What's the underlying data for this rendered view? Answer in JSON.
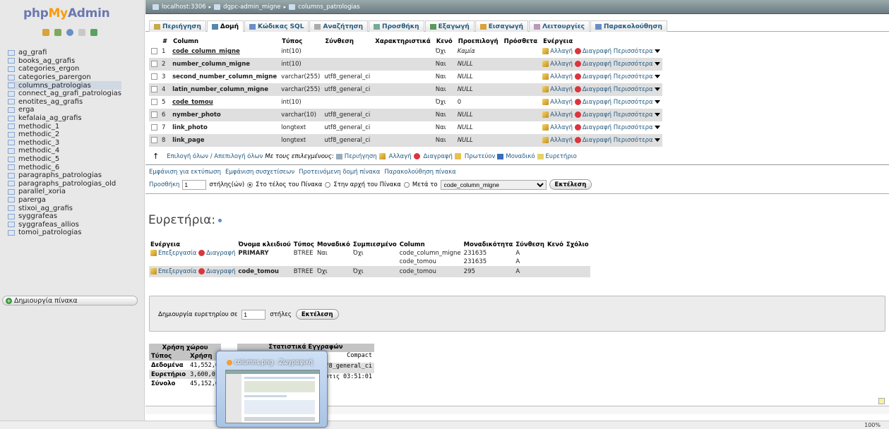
{
  "logo": {
    "php": "php",
    "my": "My",
    "admin": "Admin"
  },
  "sidebar": {
    "tables": [
      "ag_grafi",
      "books_ag_grafis",
      "categories_ergon",
      "categories_parergon",
      "columns_patrologias",
      "connect_ag_grafi_patrologias",
      "enotites_ag_grafis",
      "erga",
      "kefalaia_ag_grafis",
      "methodic_1",
      "methodic_2",
      "methodic_3",
      "methodic_4",
      "methodic_5",
      "methodic_6",
      "paragraphs_patrologias",
      "paragraphs_patrologias_old",
      "parallel_xoria",
      "parerga",
      "stixoi_ag_grafis",
      "syggrafeas",
      "syggrafeas_allios",
      "tomoi_patrologias"
    ],
    "selected_index": 4,
    "create_table": "Δημιουργία πίνακα"
  },
  "breadcrumb": {
    "server": "localhost:3306",
    "database": "dgpc-admin_migne",
    "table": "columns_patrologias"
  },
  "tabs": [
    "Περιήγηση",
    "Δομή",
    "Κώδικας SQL",
    "Αναζήτηση",
    "Προσθήκη",
    "Εξαγωγή",
    "Εισαγωγή",
    "Λειτουργίες",
    "Παρακολούθηση"
  ],
  "active_tab": 1,
  "structure": {
    "headers": [
      "#",
      "Column",
      "Τύπος",
      "Σύνθεση",
      "Χαρακτηριστικά",
      "Κενό",
      "Προεπιλογή",
      "Πρόσθετα",
      "Ενέργεια"
    ],
    "rows": [
      {
        "n": "1",
        "name": "code_column_migne",
        "underline": true,
        "type": "int(10)",
        "coll": "",
        "attr": "",
        "null": "Όχι",
        "def": "Καμία",
        "def_italic": true
      },
      {
        "n": "2",
        "name": "number_column_migne",
        "underline": false,
        "type": "int(10)",
        "coll": "",
        "attr": "",
        "null": "Ναι",
        "def": "NULL",
        "def_italic": true
      },
      {
        "n": "3",
        "name": "second_number_column_migne",
        "underline": false,
        "type": "varchar(255)",
        "coll": "utf8_general_ci",
        "attr": "",
        "null": "Ναι",
        "def": "NULL",
        "def_italic": true
      },
      {
        "n": "4",
        "name": "latin_number_column_migne",
        "underline": false,
        "type": "varchar(255)",
        "coll": "utf8_general_ci",
        "attr": "",
        "null": "Ναι",
        "def": "NULL",
        "def_italic": true
      },
      {
        "n": "5",
        "name": "code_tomou",
        "underline": true,
        "type": "int(10)",
        "coll": "",
        "attr": "",
        "null": "Όχι",
        "def": "0",
        "def_italic": false
      },
      {
        "n": "6",
        "name": "nymber_photo",
        "underline": false,
        "type": "varchar(10)",
        "coll": "utf8_general_ci",
        "attr": "",
        "null": "Ναι",
        "def": "NULL",
        "def_italic": true
      },
      {
        "n": "7",
        "name": "link_photo",
        "underline": false,
        "type": "longtext",
        "coll": "utf8_general_ci",
        "attr": "",
        "null": "Ναι",
        "def": "NULL",
        "def_italic": true
      },
      {
        "n": "8",
        "name": "link_page",
        "underline": false,
        "type": "longtext",
        "coll": "utf8_general_ci",
        "attr": "",
        "null": "Ναι",
        "def": "NULL",
        "def_italic": true
      }
    ],
    "actions": {
      "change": "Αλλαγή",
      "drop": "Διαγραφή",
      "more": "Περισσότερα"
    }
  },
  "with_selected": {
    "select_all": "Επιλογή όλων / Απεπιλογή όλων",
    "label": "Με τους επιλεγμένους:",
    "browse": "Περιήγηση",
    "change": "Αλλαγή",
    "drop": "Διαγραφή",
    "primary": "Πρωτεύον",
    "unique": "Μοναδικό",
    "index": "Ευρετήριο"
  },
  "links": {
    "print": "Εμφάνιση για εκτύπωση",
    "relations": "Εμφάνιση συσχετίσεων",
    "propose": "Προτεινόμενη δομή πίνακα",
    "track": "Παρακολούθηση πίνακα"
  },
  "add_field": {
    "label": "Προσθήκη",
    "count": "1",
    "fields": "στήλης(ών)",
    "at_end": "Στο τέλος του Πίνακα",
    "at_begin": "Στην αρχή του Πίνακα",
    "after": "Μετά το",
    "after_value": "code_column_migne",
    "go": "Εκτέλεση"
  },
  "indexes": {
    "title": "Ευρετήρια:",
    "headers": [
      "Ενέργεια",
      "Όνομα κλειδιού",
      "Τύπος",
      "Μοναδικό",
      "Συμπιεσμένο",
      "Column",
      "Μοναδικότητα",
      "Σύνθεση",
      "Κενό",
      "Σχόλιο"
    ],
    "edit": "Επεξεργασία",
    "drop": "Διαγραφή",
    "rows": [
      {
        "key": "PRIMARY",
        "type": "BTREE",
        "unique": "Ναι",
        "packed": "Όχι",
        "cols": [
          {
            "col": "code_column_migne",
            "card": "231635",
            "coll": "A"
          },
          {
            "col": "code_tomou",
            "card": "231635",
            "coll": "A"
          }
        ]
      },
      {
        "key": "code_tomou",
        "type": "BTREE",
        "unique": "Όχι",
        "packed": "Όχι",
        "cols": [
          {
            "col": "code_tomou",
            "card": "295",
            "coll": "A"
          }
        ]
      }
    ]
  },
  "create_index": {
    "label": "Δημιουργία ευρετηρίου σε",
    "count": "1",
    "cols": "στήλες",
    "go": "Εκτέλεση"
  },
  "space": {
    "title": "Χρήση χώρου",
    "h_type": "Τύπος",
    "h_use": "Χρήση",
    "rows": [
      {
        "k": "Δεδομένα",
        "v": "41,552,0"
      },
      {
        "k": "Ευρετήριο",
        "v": "3,600,0"
      },
      {
        "k": "Σύνολο",
        "v": "45,152,0"
      }
    ]
  },
  "stats": {
    "title": "Στατιστικά Εγγραφών",
    "rows": [
      "Compact",
      "f8_general_ci",
      "στις 03:51:01"
    ]
  },
  "thumbnail": {
    "title": "columns.png - Ζωγραφική"
  },
  "zoom": "100%"
}
